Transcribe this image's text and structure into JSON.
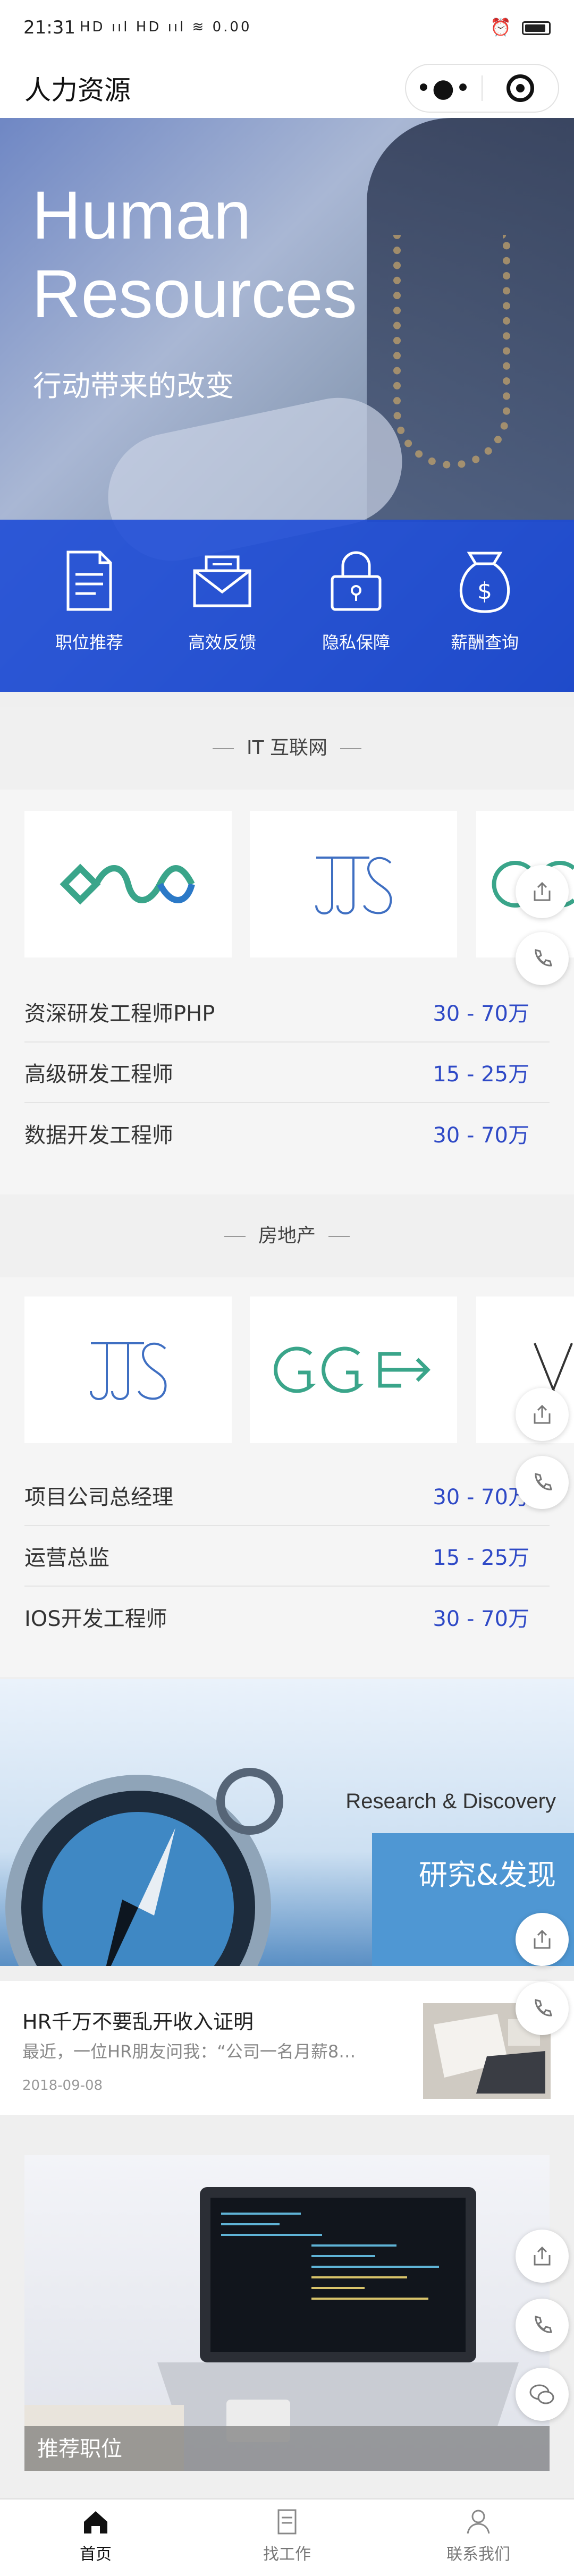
{
  "status_bar": {
    "time": "21:31",
    "signal_icons": "HD ııl HD ııl ≋ 0.00",
    "right_icons": [
      "alarm-icon",
      "battery-icon"
    ]
  },
  "title_bar": {
    "title": "人力资源",
    "more_icon": "more-dots-icon",
    "close_icon": "target-icon"
  },
  "hero": {
    "title_line1": "Human",
    "title_line2": "Resources",
    "subtitle": "行动带来的改变",
    "nav": [
      {
        "label": "职位推荐",
        "icon": "document-icon"
      },
      {
        "label": "高效反馈",
        "icon": "mail-icon"
      },
      {
        "label": "隐私保障",
        "icon": "lock-icon"
      },
      {
        "label": "薪酬查询",
        "icon": "money-bag-icon"
      }
    ]
  },
  "sections": [
    {
      "heading": "IT 互联网",
      "logos": [
        "wave-logo",
        "js-logo",
        "green-logo-partial"
      ],
      "jobs": [
        {
          "title": "资深研发工程师PHP",
          "salary": "30 - 70万"
        },
        {
          "title": "高级研发工程师",
          "salary": "15 - 25万"
        },
        {
          "title": "数据开发工程师",
          "salary": "30 - 70万"
        }
      ]
    },
    {
      "heading": "房地产",
      "logos": [
        "js-logo",
        "gge-logo",
        "partial-logo"
      ],
      "jobs": [
        {
          "title": "项目公司总经理",
          "salary": "30 - 70万"
        },
        {
          "title": "运营总监",
          "salary": "15 - 25万"
        },
        {
          "title": "IOS开发工程师",
          "salary": "30 - 70万"
        }
      ]
    }
  ],
  "banner": {
    "en": "Research & Discovery",
    "cn": "研究&发现"
  },
  "article": {
    "title": "HR千万不要乱开收入证明",
    "desc": "最近，一位HR朋友问我：“公司一名月薪8…",
    "date": "2018-09-08"
  },
  "promo": {
    "label": "推荐职位"
  },
  "tabbar": [
    {
      "label": "首页",
      "icon": "home-icon",
      "active": true
    },
    {
      "label": "找工作",
      "icon": "document-icon",
      "active": false
    },
    {
      "label": "联系我们",
      "icon": "user-icon",
      "active": false
    }
  ],
  "colors": {
    "accent": "#2e49c6",
    "hero_band": "#1b4ad6",
    "banner_blue": "#4f97d3"
  }
}
